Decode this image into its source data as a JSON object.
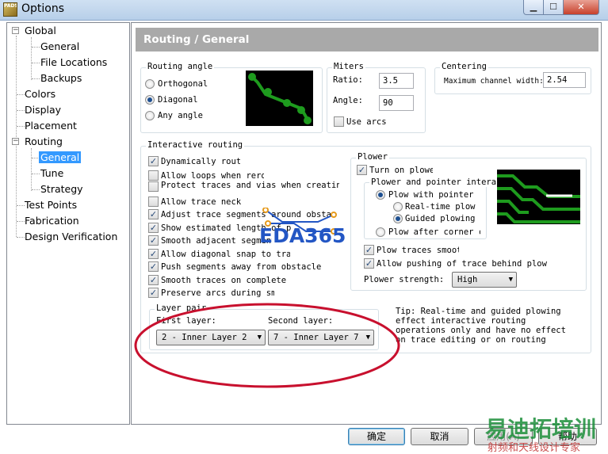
{
  "window": {
    "icon_text": "PADS",
    "title": "Options",
    "min_glyph": "▁",
    "max_glyph": "☐",
    "close_glyph": "✕"
  },
  "tree": {
    "items": [
      {
        "label": "Global",
        "expander": "−"
      },
      {
        "label": "General"
      },
      {
        "label": "File Locations"
      },
      {
        "label": "Backups"
      },
      {
        "label": "Colors"
      },
      {
        "label": "Display"
      },
      {
        "label": "Placement"
      },
      {
        "label": "Routing",
        "expander": "−"
      },
      {
        "label": "General",
        "selected": true
      },
      {
        "label": "Tune"
      },
      {
        "label": "Strategy"
      },
      {
        "label": "Test Points"
      },
      {
        "label": "Fabrication"
      },
      {
        "label": "Design Verification"
      }
    ]
  },
  "page": {
    "header": "Routing / General"
  },
  "routing_angle": {
    "label": "Routing angle",
    "options": [
      "Orthogonal",
      "Diagonal",
      "Any angle"
    ],
    "selected": "Diagonal"
  },
  "miters": {
    "label": "Miters",
    "ratio_label": "Ratio:",
    "ratio_value": "3.5",
    "angle_label": "Angle:",
    "angle_value": "90",
    "use_arcs_label": "Use arcs",
    "use_arcs_checked": false
  },
  "centering": {
    "label": "Centering",
    "max_channel_label": "Maximum channel width:",
    "max_channel_value": "2.54"
  },
  "interactive_routing": {
    "label": "Interactive routing",
    "options": [
      {
        "label": "Dynamically route",
        "checked": true
      },
      {
        "label": "Allow loops when rerouting",
        "checked": false
      },
      {
        "label": "Protect traces and vias when creating",
        "checked": false
      },
      {
        "label": "Allow trace neck",
        "checked": false
      },
      {
        "label": "Adjust trace segments around obstacles",
        "checked": true
      },
      {
        "label": "Show estimated length of pins",
        "checked": true
      },
      {
        "label": "Smooth adjacent segments",
        "checked": true
      },
      {
        "label": "Allow diagonal snap to track",
        "checked": true
      },
      {
        "label": "Push segments away from obstacle",
        "checked": true
      },
      {
        "label": "Smooth traces on complete",
        "checked": true
      },
      {
        "label": "Preserve arcs during smoothing",
        "checked": true
      }
    ]
  },
  "layer_pair": {
    "label": "Layer pair",
    "first_label": "First layer:",
    "first_value": "2 - Inner Layer 2",
    "second_label": "Second layer:",
    "second_value": "7 - Inner Layer 7"
  },
  "plower": {
    "label": "Plower",
    "turn_on_label": "Turn on plower",
    "turn_on_checked": true,
    "interaction_label": "Plower and pointer interaction",
    "plow_with_pointer": "Plow with pointer",
    "realtime_plow": "Real-time plow",
    "guided_plowing": "Guided plowing",
    "plow_after_corner": "Plow after corner click",
    "plow_traces_smooth_label": "Plow traces smooth",
    "plow_traces_smooth_checked": true,
    "allow_pushing_label": "Allow pushing of trace behind plow",
    "allow_pushing_checked": true,
    "strength_label": "Plower strength:",
    "strength_value": "High"
  },
  "tip": {
    "lines": [
      "Tip: Real-time and guided plowing",
      "effect interactive routing",
      "operations only and have no effect",
      "on trace editing or on routing"
    ]
  },
  "buttons": {
    "ok": "确定",
    "cancel": "取消",
    "apply": "应用(A)",
    "help": "帮助"
  },
  "watermarks": {
    "eda": "EDA365",
    "bottom_main": "易迪拓培训",
    "bottom_sub": "射频和天线设计专家"
  },
  "colors": {
    "selection": "#3399ff",
    "header_bar": "#a9a9a9",
    "annotation_ellipse": "#c8102e",
    "trace_green": "#1e9b1e"
  }
}
